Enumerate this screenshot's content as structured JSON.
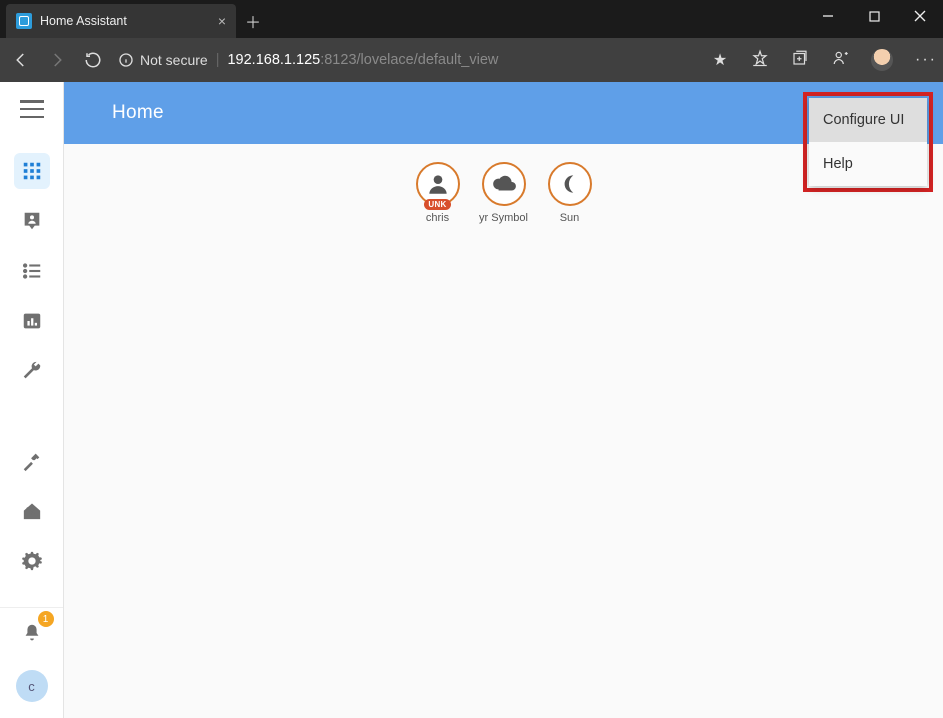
{
  "browser": {
    "tab_title": "Home Assistant",
    "security_label": "Not secure",
    "url_host": "192.168.1.125",
    "url_port_path": ":8123/lovelace/default_view"
  },
  "app": {
    "header_title": "Home",
    "menu": {
      "configure": "Configure UI",
      "help": "Help"
    }
  },
  "entities": [
    {
      "label": "chris",
      "icon": "person",
      "unk": "UNK"
    },
    {
      "label": "yr Symbol",
      "icon": "cloud"
    },
    {
      "label": "Sun",
      "icon": "moon"
    }
  ],
  "sidebar": {
    "notification_count": "1",
    "user_initial": "c"
  }
}
